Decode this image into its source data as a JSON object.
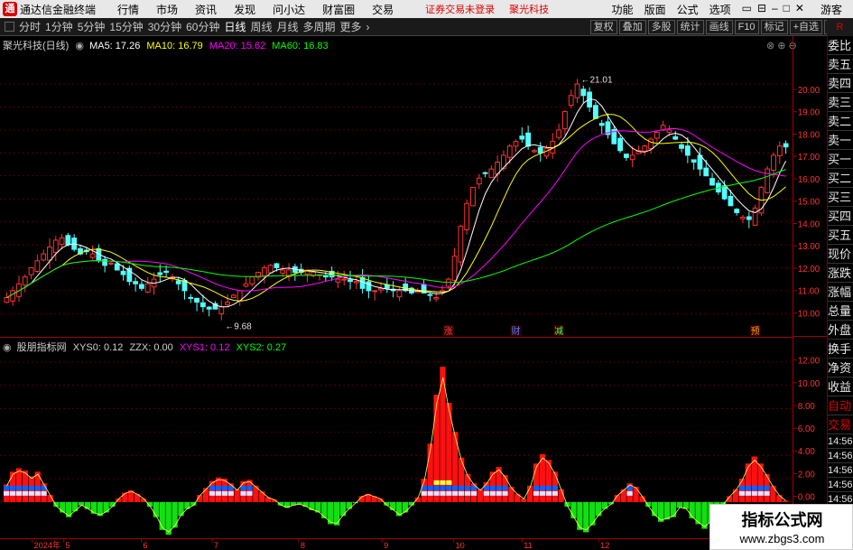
{
  "titlebar": {
    "app_title": "通达信金融终端",
    "menus": [
      "行情",
      "市场",
      "资讯",
      "发现",
      "问小达",
      "财富圈",
      "交易"
    ],
    "notice": "证券交易未登录",
    "notice_stock": "聚光科技",
    "right_menus": [
      "功能",
      "版面",
      "公式",
      "选项"
    ],
    "guest": "游客"
  },
  "toolbar": {
    "periods": [
      "分时",
      "1分钟",
      "5分钟",
      "15分钟",
      "30分钟",
      "60分钟",
      "日线",
      "周线",
      "月线",
      "多周期",
      "更多"
    ],
    "active_period": "日线",
    "buttons": [
      "复权",
      "叠加",
      "多股",
      "统计",
      "画线",
      "F10",
      "标记",
      "+自选",
      "返回"
    ]
  },
  "main_legend": {
    "stock_title": "聚光科技(日线)",
    "ma5": "MA5: 17.26",
    "ma10": "MA10: 16.79",
    "ma20": "MA20: 15.62",
    "ma60": "MA60: 16.83"
  },
  "sub_legend": {
    "indicator": "股朋指标网",
    "xys0": "XYS0: 0.12",
    "zzx": "ZZX: 0.00",
    "xys1": "XYS1: 0.12",
    "xys2": "XYS2: 0.27"
  },
  "annotations": {
    "high": "21.01",
    "low": "9.68",
    "markers": [
      "涨",
      "财",
      "减",
      "预"
    ]
  },
  "side_panel": {
    "items": [
      "委比",
      "卖五",
      "卖四",
      "卖三",
      "卖二",
      "卖一",
      "买一",
      "买二",
      "买三",
      "买四",
      "买五",
      "现价",
      "涨跌",
      "涨幅",
      "总量",
      "外盘",
      "换手",
      "净资",
      "收益",
      "自动",
      "交易",
      "14:56",
      "14:56",
      "14:56",
      "14:56",
      "14:56",
      "14:56",
      "14:56"
    ],
    "top_badge": "R"
  },
  "dates": [
    "2024年",
    "5",
    "6",
    "7",
    "8",
    "9",
    "10",
    "11",
    "12"
  ],
  "colors": {
    "up": "#ff3232",
    "down": "#54ffff",
    "ma5": "#ffffff",
    "ma10": "#ffff00",
    "ma20": "#ff00ff",
    "ma60": "#00ff00",
    "grid": "#8b0000",
    "axis_text": "#ff3232"
  },
  "chart_data": [
    {
      "type": "candlestick",
      "title": "聚光科技(日线)",
      "y_ticks": [
        "20.00",
        "19.00",
        "18.00",
        "17.00",
        "16.00",
        "15.00",
        "14.00",
        "13.00",
        "12.00",
        "11.00",
        "10.00"
      ],
      "ylim": [
        9.5,
        21.3
      ],
      "x_months": [
        "2024年",
        "5",
        "6",
        "7",
        "8",
        "9",
        "10",
        "11",
        "12"
      ],
      "closes": [
        10.7,
        11.0,
        11.3,
        11.6,
        12.0,
        12.3,
        12.6,
        12.9,
        13.2,
        13.3,
        13.0,
        12.8,
        12.6,
        12.7,
        12.6,
        12.3,
        12.1,
        12.2,
        11.9,
        11.7,
        11.4,
        11.3,
        11.1,
        11.3,
        11.5,
        11.7,
        11.8,
        11.6,
        11.3,
        11.0,
        10.7,
        10.5,
        10.3,
        10.2,
        10.2,
        10.3,
        10.5,
        10.8,
        11.0,
        11.3,
        11.6,
        11.8,
        12.0,
        12.1,
        12.0,
        11.9,
        11.9,
        11.8,
        11.8,
        11.9,
        11.8,
        11.7,
        11.6,
        11.6,
        11.5,
        11.5,
        11.4,
        11.4,
        11.1,
        11.0,
        11.0,
        11.1,
        11.1,
        11.0,
        11.0,
        11.0,
        10.9,
        11.0,
        10.9,
        10.8,
        10.7,
        11.0,
        11.5,
        12.5,
        13.8,
        14.8,
        15.5,
        15.9,
        16.1,
        16.3,
        16.6,
        16.9,
        17.3,
        17.5,
        17.6,
        17.3,
        17.1,
        17.0,
        17.2,
        17.5,
        18.0,
        18.8,
        19.5,
        20.0,
        19.5,
        19.0,
        18.5,
        18.2,
        17.8,
        17.4,
        17.1,
        16.8,
        16.9,
        17.1,
        17.3,
        17.6,
        17.9,
        18.2,
        18.0,
        17.6,
        17.2,
        16.9,
        16.6,
        16.3,
        16.0,
        15.6,
        15.3,
        15.0,
        14.7,
        14.4,
        14.2,
        14.1,
        14.6,
        15.5,
        16.3,
        16.9,
        17.3,
        17.26
      ],
      "ma_lines": [
        "MA5",
        "MA10",
        "MA20",
        "MA60"
      ],
      "high": "21.01",
      "low": "9.68"
    },
    {
      "type": "bar",
      "title": "股朋指标网",
      "series": [
        {
          "name": "XYS0",
          "last": "0.12"
        },
        {
          "name": "ZZX",
          "last": "0.00"
        },
        {
          "name": "XYS1",
          "last": "0.12"
        },
        {
          "name": "XYS2",
          "last": "0.27"
        }
      ],
      "y_ticks": [
        "12.00",
        "10.00",
        "8.00",
        "6.00",
        "4.00",
        "2.00",
        "0.00"
      ],
      "ylim": [
        -2.8,
        13.0
      ],
      "values": [
        1.5,
        2.6,
        2.9,
        2.7,
        2.2,
        2.6,
        1.6,
        0.6,
        -0.4,
        -0.9,
        -1.3,
        -0.8,
        -0.3,
        -0.6,
        -1.0,
        -1.2,
        -0.9,
        -0.4,
        0.3,
        0.8,
        1.0,
        0.7,
        0.3,
        -0.4,
        -1.3,
        -2.4,
        -2.8,
        -2.2,
        -1.2,
        -0.6,
        -0.3,
        0.6,
        1.2,
        1.8,
        2.1,
        2.0,
        1.6,
        1.1,
        1.8,
        1.9,
        1.4,
        0.9,
        0.4,
        0.2,
        -0.3,
        -0.5,
        -0.3,
        -0.2,
        -0.4,
        -0.7,
        -0.9,
        -1.4,
        -1.9,
        -2.0,
        -1.2,
        -0.6,
        -0.1,
        0.5,
        0.7,
        0.5,
        0.3,
        -0.3,
        -0.7,
        -1.2,
        -0.9,
        -0.3,
        0.4,
        2.0,
        5.0,
        9.2,
        11.6,
        8.5,
        6.0,
        3.8,
        2.4,
        1.6,
        1.1,
        1.7,
        2.6,
        3.0,
        2.3,
        1.3,
        0.7,
        0.3,
        1.4,
        3.3,
        4.1,
        3.6,
        2.6,
        1.1,
        -0.4,
        -1.4,
        -2.4,
        -2.6,
        -2.0,
        -1.2,
        -0.6,
        -0.2,
        0.6,
        1.1,
        1.6,
        1.3,
        0.5,
        -0.4,
        -1.2,
        -1.7,
        -1.5,
        -1.3,
        -0.5,
        -0.6,
        -1.4,
        -1.9,
        -2.3,
        -1.8,
        -0.9,
        -0.2,
        0.5,
        1.1,
        2.0,
        3.3,
        3.9,
        3.3,
        2.4,
        1.4,
        0.6,
        0.12
      ]
    }
  ]
}
